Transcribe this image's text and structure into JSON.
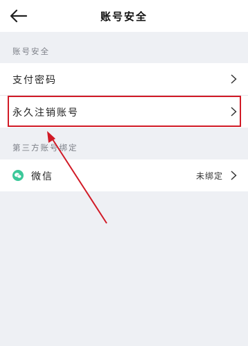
{
  "header": {
    "title": "账号安全",
    "back_icon": "arrow-left-icon"
  },
  "sections": {
    "account_security_label": "账号安全",
    "payment_password": "支付密码",
    "delete_account": "永久注销账号",
    "third_party_label": "第三方账号绑定"
  },
  "wechat": {
    "label": "微信",
    "status": "未绑定",
    "icon": "wechat-icon",
    "icon_color": "#3cc89a"
  },
  "colors": {
    "background": "#eef0f4",
    "highlight": "#d11a26"
  }
}
